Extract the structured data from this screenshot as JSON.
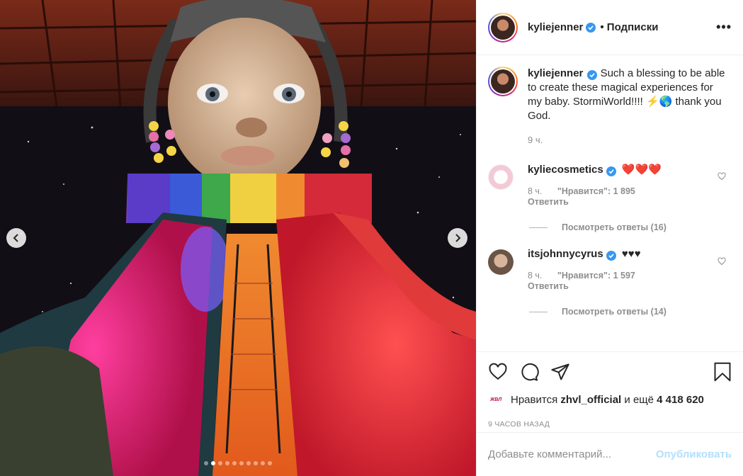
{
  "post": {
    "author": "kyliejenner",
    "follow_label": "• Подписки",
    "more_label": "•••"
  },
  "caption": {
    "username": "kyliejenner",
    "text": "Such a blessing to be able to create these magical experiences for my baby. StormiWorld!!!! ⚡🌎 thank you God.",
    "time": "9 ч."
  },
  "comments": [
    {
      "username": "kyliecosmetics",
      "text": "❤️❤️❤️",
      "time": "8 ч.",
      "likes": "\"Нравится\": 1 895",
      "reply_label": "Ответить",
      "view_replies": "Посмотреть ответы (16)"
    },
    {
      "username": "itsjohnnycyrus",
      "text": "♥♥♥",
      "time": "8 ч.",
      "likes": "\"Нравится\": 1 597",
      "reply_label": "Ответить",
      "view_replies": "Посмотреть ответы (14)"
    }
  ],
  "likes": {
    "avatar_text": "ЖВЛ",
    "prefix": "Нравится",
    "user": "zhvl_official",
    "middle": "и ещё",
    "count": "4 418 620"
  },
  "timestamp": "9 ЧАСОВ НАЗАД",
  "comment_box": {
    "placeholder": "Добавьте комментарий...",
    "publish_label": "Опубликовать"
  },
  "carousel": {
    "slide_count": 10,
    "active_index": 1
  },
  "colors": {
    "verified": "#3897f0",
    "publish_disabled": "#b2dffc",
    "muted": "#8e8e8e"
  }
}
